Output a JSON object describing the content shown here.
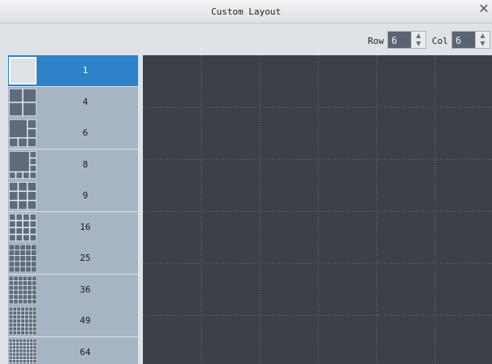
{
  "window": {
    "title": "Custom Layout",
    "close_icon": "close-icon"
  },
  "toolbar": {
    "row_label": "Row",
    "row_value": "6",
    "col_label": "Col",
    "col_value": "6"
  },
  "layouts": [
    {
      "count": "1",
      "grid": 1,
      "selected": true
    },
    {
      "count": "4",
      "grid": 2
    },
    {
      "count": "6",
      "grid": 3
    },
    {
      "count": "8",
      "grid": 4
    },
    {
      "count": "9",
      "grid": 3
    },
    {
      "count": "16",
      "grid": 4
    },
    {
      "count": "25",
      "grid": 5
    },
    {
      "count": "36",
      "grid": 6
    },
    {
      "count": "49",
      "grid": 7
    },
    {
      "count": "64",
      "grid": 8
    }
  ],
  "colors": {
    "selected": "#2d82c8",
    "item_bg": "#a7b4c3",
    "canvas_bg": "#3c4049",
    "grid_line": "#6b7a3a"
  }
}
